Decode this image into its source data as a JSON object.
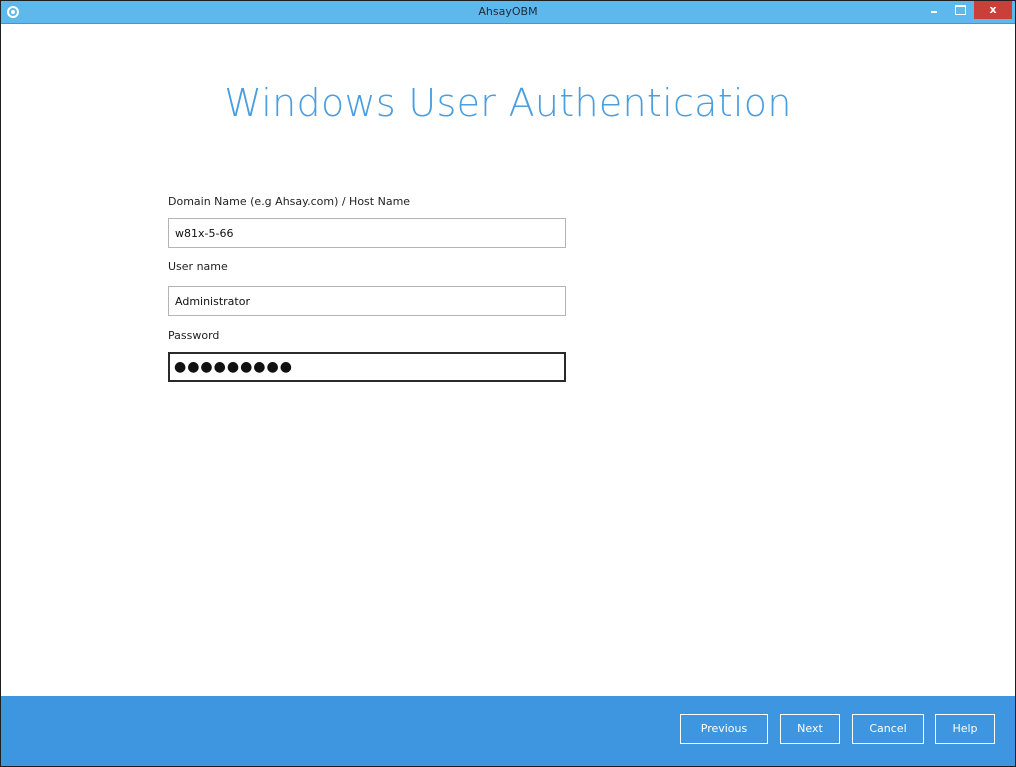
{
  "window": {
    "title": "AhsayOBM",
    "minimize_glyph": "",
    "maximize_glyph": "",
    "close_glyph": "x"
  },
  "page": {
    "heading": "Windows User Authentication"
  },
  "form": {
    "domain": {
      "label": "Domain Name (e.g Ahsay.com) / Host Name",
      "value": "w81x-5-66"
    },
    "username": {
      "label": "User name",
      "value": "Administrator"
    },
    "password": {
      "label": "Password",
      "value": "●●●●●●●●●"
    }
  },
  "footer": {
    "previous_label": "Previous",
    "next_label": "Next",
    "cancel_label": "Cancel",
    "help_label": "Help"
  },
  "colors": {
    "titlebar": "#5fb8ec",
    "accent": "#4a9ee0",
    "footer": "#3f96e0",
    "close": "#c9403a"
  },
  "icons": {
    "app": "app-icon",
    "minimize": "minimize-icon",
    "maximize": "maximize-icon",
    "close": "close-icon"
  }
}
